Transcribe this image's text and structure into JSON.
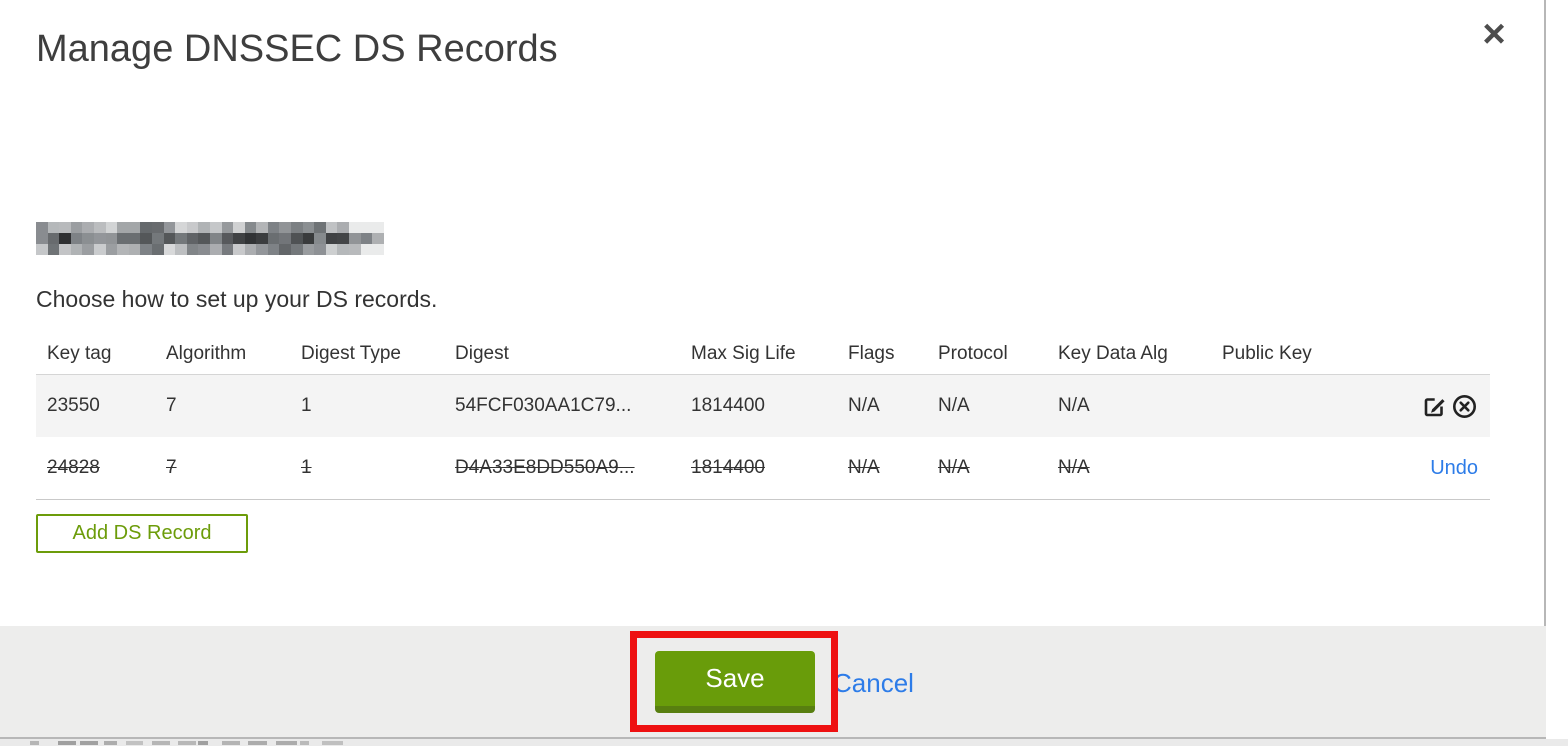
{
  "window": {
    "title": "Manage DNSSEC DS Records",
    "subtitle": "Choose how to set up your DS records."
  },
  "icons": {
    "close": "×",
    "edit": "pencil-in-square",
    "remove": "x-in-circle"
  },
  "table": {
    "headers": [
      "Key tag",
      "Algorithm",
      "Digest Type",
      "Digest",
      "Max Sig Life",
      "Flags",
      "Protocol",
      "Key Data Alg",
      "Public Key"
    ],
    "rows": [
      {
        "key_tag": "23550",
        "algorithm": "7",
        "digest_type": "1",
        "digest": "54FCF030AA1C79...",
        "max_sig_life": "1814400",
        "flags": "N/A",
        "protocol": "N/A",
        "key_data_alg": "N/A",
        "public_key": "",
        "state": "current",
        "actions": [
          "edit",
          "remove"
        ]
      },
      {
        "key_tag": "24828",
        "algorithm": "7",
        "digest_type": "1",
        "digest": "D4A33E8DD550A9...",
        "max_sig_life": "1814400",
        "flags": "N/A",
        "protocol": "N/A",
        "key_data_alg": "N/A",
        "public_key": "",
        "state": "deleted",
        "actions": [
          "undo"
        ],
        "undo_label": "Undo"
      }
    ]
  },
  "buttons": {
    "add_ds_record": "Add DS Record",
    "save": "Save",
    "cancel": "Cancel"
  },
  "colors": {
    "accent_green": "#699c0a",
    "accent_green_dark": "#587f10",
    "outline_green": "#6c9c0a",
    "link_blue": "#2d7ce8",
    "annotation_red": "#ee1111",
    "footer_gray": "#ededec",
    "row_gray": "#f4f4f4"
  }
}
